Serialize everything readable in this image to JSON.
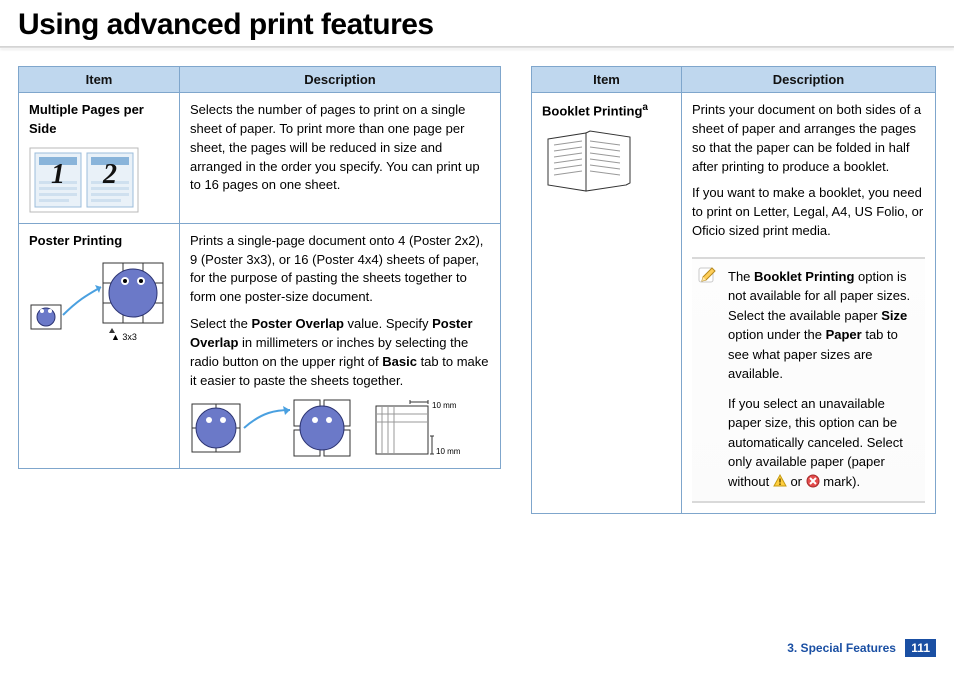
{
  "title": "Using advanced print features",
  "table_headers": {
    "item": "Item",
    "description": "Description"
  },
  "left": {
    "rows": [
      {
        "item": "Multiple Pages per Side",
        "desc": "Selects the number of pages to print on a single sheet of paper. To print more than one page per sheet, the pages will be reduced in size and arranged in the order you specify. You can print up to 16 pages on one sheet."
      },
      {
        "item": "Poster Printing",
        "desc_p1_pre": "Prints a single-page document onto 4 (Poster 2x2), 9 (Poster 3x3), or 16 (Poster 4x4) sheets of paper, for the purpose of pasting the sheets together to form one poster-size document.",
        "desc_p2_a": "Select the ",
        "desc_p2_b": "Poster Overlap",
        "desc_p2_c": " value. Specify ",
        "desc_p2_d": "Poster Overlap",
        "desc_p2_e": " in millimeters or inches by selecting the radio button on the upper right of ",
        "desc_p2_f": "Basic",
        "desc_p2_g": " tab to make it easier to paste the sheets together.",
        "caption_3x3": "3x3",
        "mm_h": "10 mm",
        "mm_v": "10 mm"
      }
    ]
  },
  "right": {
    "rows": [
      {
        "item_prefix": "Booklet Printing",
        "item_sup": "a",
        "desc_p1": "Prints your document on both sides of a sheet of paper and arranges the pages so that the paper can be folded in half after printing to produce a booklet.",
        "desc_p2": "If you want to make a booklet, you need to print on Letter, Legal, A4, US Folio, or Oficio sized print media.",
        "note_p1_a": "The ",
        "note_p1_b": "Booklet Printing",
        "note_p1_c": " option is not available for all paper sizes. Select the available paper ",
        "note_p1_d": "Size",
        "note_p1_e": " option under the ",
        "note_p1_f": "Paper",
        "note_p1_g": " tab to see what paper sizes are available.",
        "note_p2_a": "If you select an unavailable paper size, this option can be automatically canceled. Select only available paper (paper without ",
        "note_p2_b": " or ",
        "note_p2_c": " mark)."
      }
    ]
  },
  "footer": {
    "chapter": "3.  Special Features",
    "page": "111"
  }
}
